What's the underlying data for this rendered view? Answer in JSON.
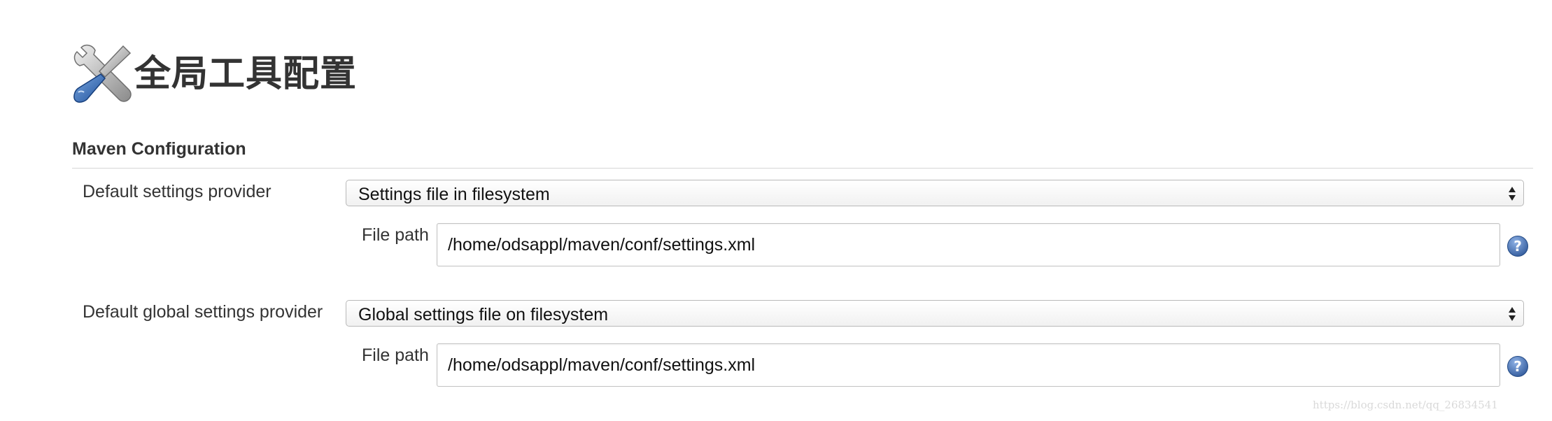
{
  "page": {
    "title": "全局工具配置",
    "title_icon": "wrench-screwdriver-icon"
  },
  "maven_configuration": {
    "heading": "Maven Configuration",
    "settings_provider": {
      "label": "Default settings provider",
      "selected": "Settings file in filesystem",
      "file_path_label": "File path",
      "file_path_value": "/home/odsappl/maven/conf/settings.xml",
      "help_icon": "help-icon"
    },
    "global_settings_provider": {
      "label": "Default global settings provider",
      "selected": "Global settings file on filesystem",
      "file_path_label": "File path",
      "file_path_value": "/home/odsappl/maven/conf/settings.xml",
      "help_icon": "help-icon"
    }
  },
  "watermark": "https://blog.csdn.net/qq_26834541",
  "colors": {
    "text": "#333333",
    "help_icon_blue": "#3f68a8",
    "border": "#b9b9b9",
    "watermark": "#d9d9d9"
  }
}
